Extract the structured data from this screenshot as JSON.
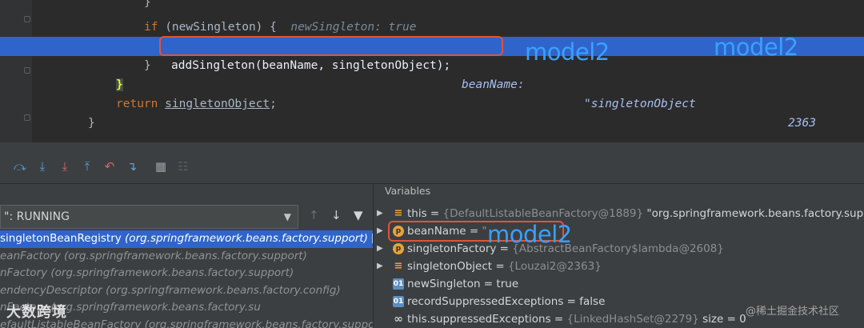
{
  "editor": {
    "lines": {
      "l1": "}",
      "l2_kw": "if",
      "l2_code": " (newSingleton) {",
      "l2_hint": "newSingleton: true",
      "l3_code": "addSingleton(beanName, singletonObject);",
      "l3_hint_a": "beanName: ",
      "l3_hint_b": "\"singletonObject",
      "l3_hint_c": "2363",
      "l4": "}",
      "l5": "}",
      "l6_kw": "return",
      "l6_var": "singletonObject",
      "l6_end": ";",
      "l7": "}"
    },
    "overlay_label": "model2"
  },
  "debugger": {
    "thread": "\": RUNNING",
    "frames": [
      {
        "method": "singletonBeanRegistry",
        "pkg": " (org.springframework.beans.factory.support)",
        "suffix": " [",
        "selected": true
      },
      {
        "method": "eanFactory",
        "pkg": " (org.springframework.beans.factory.support)",
        "suffix": "",
        "selected": false
      },
      {
        "method": "nFactory",
        "pkg": " (org.springframework.beans.factory.support)",
        "suffix": "",
        "selected": false
      },
      {
        "method": "endencyDescriptor",
        "pkg": " (org.springframework.beans.factory.config)",
        "suffix": "",
        "selected": false
      },
      {
        "method": "nFactory",
        "pkg": " (org.springframework.beans.factory.su",
        "suffix": "",
        "selected": false
      },
      {
        "method": "efaultListableBeanFactory",
        "pkg": " (org.springframework.beans.factory.suppo",
        "suffix": "",
        "selected": false
      }
    ],
    "variables_header": "Variables",
    "variables": [
      {
        "name": "this",
        "ref": "{DefaultListableBeanFactory@1889}",
        "value": " \"org.springframework.beans.factory.suppo"
      },
      {
        "name": "beanName",
        "ref": "",
        "value": " \""
      },
      {
        "name": "singletonFactory",
        "ref": "{AbstractBeanFactory$lambda@2608}",
        "value": ""
      },
      {
        "name": "singletonObject",
        "ref": "{Louzai2@2363}",
        "value": ""
      },
      {
        "name": "newSingleton",
        "ref": "",
        "value": "true"
      },
      {
        "name": "recordSuppressedExceptions",
        "ref": "",
        "value": "false"
      },
      {
        "name": "this.suppressedExceptions",
        "ref": "{LinkedHashSet@2279}",
        "value": "  size = 0"
      }
    ]
  },
  "watermarks": {
    "left": "大数跨境",
    "right": "@稀土掘金技术社区"
  },
  "colors": {
    "highlight": "#2f65ca",
    "annotation_box": "#e0533b",
    "overlay_text": "#3aa0ff"
  },
  "icons": [
    "step-over-icon",
    "step-into-icon",
    "force-step-into-icon",
    "step-out-icon",
    "drop-frame-icon",
    "run-to-cursor-icon",
    "evaluate-icon",
    "trace-icon",
    "filter-icon",
    "up-arrow-icon",
    "down-arrow-icon"
  ]
}
